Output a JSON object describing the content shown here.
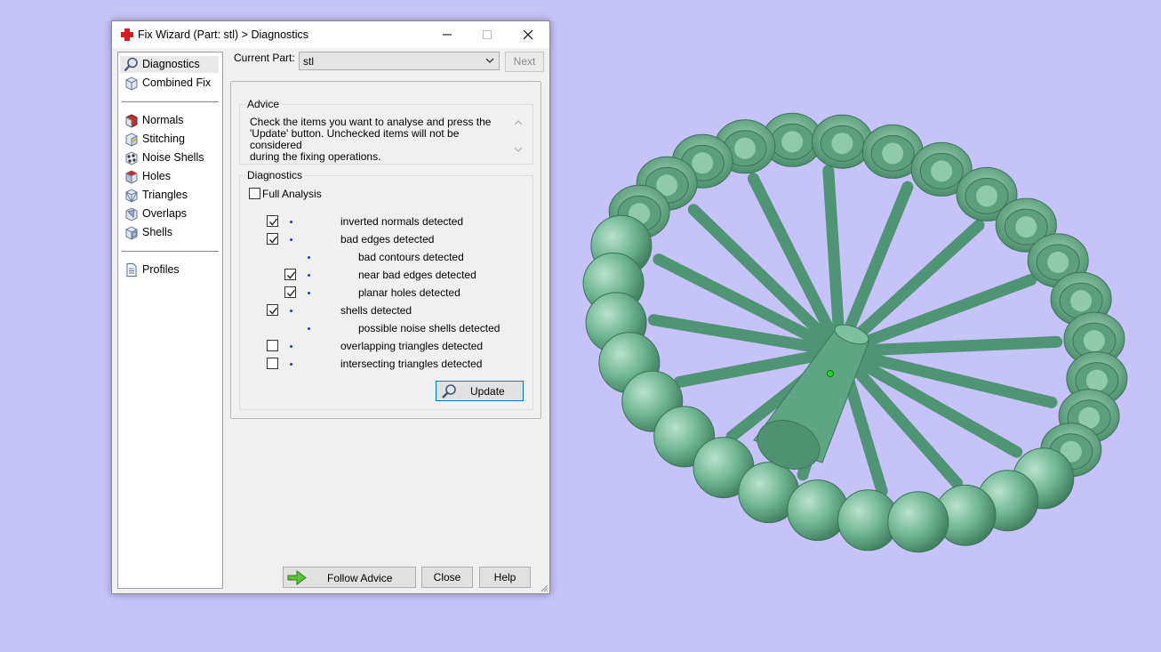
{
  "window": {
    "title": "Fix Wizard (Part: stl) > Diagnostics"
  },
  "nav": {
    "items": [
      {
        "label": "Diagnostics",
        "icon": "magnifier-icon",
        "selected": true
      },
      {
        "label": "Combined Fix",
        "icon": "cube-icon"
      },
      {
        "label": "Normals",
        "icon": "normals-cube-icon"
      },
      {
        "label": "Stitching",
        "icon": "stitching-cube-icon"
      },
      {
        "label": "Noise Shells",
        "icon": "noise-shells-icon"
      },
      {
        "label": "Holes",
        "icon": "holes-cube-icon"
      },
      {
        "label": "Triangles",
        "icon": "triangles-cube-icon"
      },
      {
        "label": "Overlaps",
        "icon": "overlaps-cube-icon"
      },
      {
        "label": "Shells",
        "icon": "shells-cube-icon"
      },
      {
        "label": "Profiles",
        "icon": "profile-document-icon"
      }
    ]
  },
  "current_part": {
    "label": "Current Part:",
    "value": "stl",
    "next_label": "Next"
  },
  "advice": {
    "title": "Advice",
    "lines": [
      "Check the items you want to analyse and press the",
      "'Update' button. Unchecked items will not be considered",
      "during the fixing operations."
    ]
  },
  "diagnostics": {
    "title": "Diagnostics",
    "full_analysis": {
      "label": "Full Analysis",
      "checked": false
    },
    "items": [
      {
        "label": "inverted normals detected",
        "checked": true,
        "level": 0
      },
      {
        "label": "bad edges detected",
        "checked": true,
        "level": 0
      },
      {
        "label": "bad contours detected",
        "checked": null,
        "level": 1
      },
      {
        "label": "near bad edges detected",
        "checked": true,
        "level": 1
      },
      {
        "label": "planar holes detected",
        "checked": true,
        "level": 1
      },
      {
        "label": "shells detected",
        "checked": true,
        "level": 0
      },
      {
        "label": "possible noise shells detected",
        "checked": null,
        "level": 1
      },
      {
        "label": "overlapping triangles detected",
        "checked": false,
        "level": 0
      },
      {
        "label": "intersecting triangles detected",
        "checked": false,
        "level": 0
      }
    ],
    "update_label": "Update"
  },
  "footer": {
    "follow_advice_label": "Follow Advice",
    "close_label": "Close",
    "help_label": "Help"
  },
  "colors": {
    "viewport_bg": "#c5c3f8",
    "model": "#6fb593",
    "dot_blue": "#1a3fd6",
    "accent_red": "#d81e1e"
  }
}
